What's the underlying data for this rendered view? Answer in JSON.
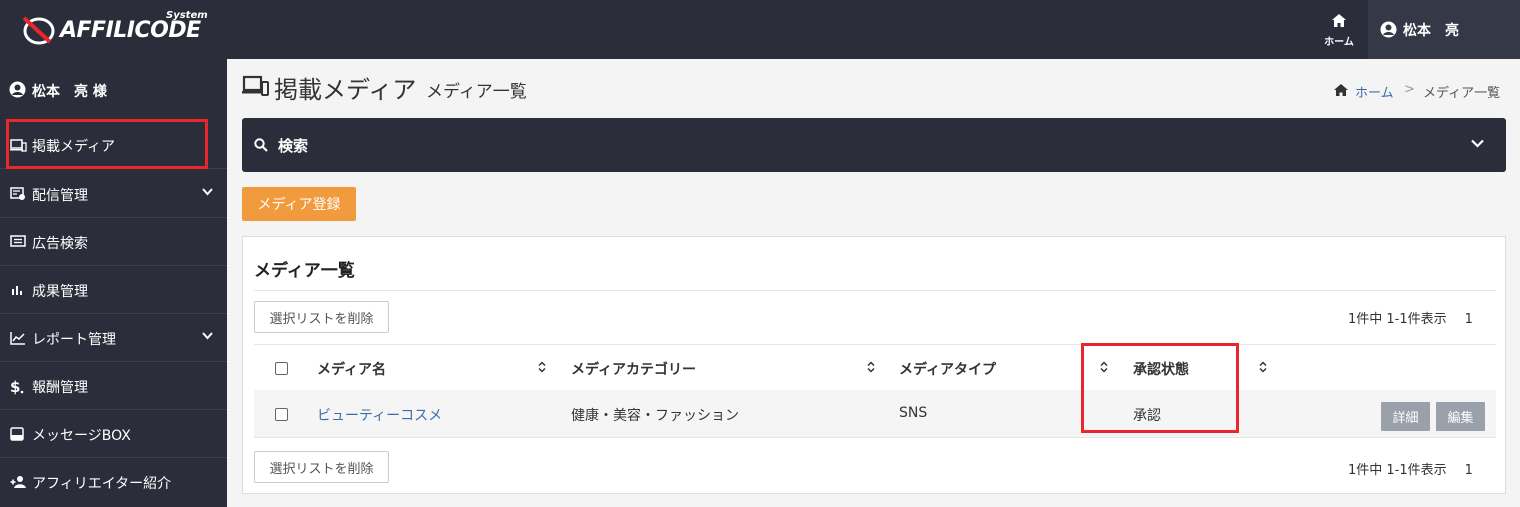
{
  "header": {
    "logo_text": "AFFILICODE",
    "logo_badge": "System",
    "home_label": "ホーム",
    "user_name": "松本　亮"
  },
  "sidebar": {
    "user_label": "松本　亮 様",
    "items": [
      {
        "label": "掲載メディア",
        "icon": "media-icon",
        "expandable": false
      },
      {
        "label": "配信管理",
        "icon": "delivery-icon",
        "expandable": true
      },
      {
        "label": "広告検索",
        "icon": "ad-list-icon",
        "expandable": false
      },
      {
        "label": "成果管理",
        "icon": "bar-chart-icon",
        "expandable": false
      },
      {
        "label": "レポート管理",
        "icon": "line-chart-icon",
        "expandable": true
      },
      {
        "label": "報酬管理",
        "icon": "dollar-icon",
        "expandable": false
      },
      {
        "label": "メッセージBOX",
        "icon": "inbox-icon",
        "expandable": false
      },
      {
        "label": "アフィリエイター紹介",
        "icon": "user-plus-icon",
        "expandable": false
      }
    ]
  },
  "page": {
    "title": "掲載メディア",
    "subtitle": "メディア一覧",
    "breadcrumb": {
      "home": "ホーム",
      "separator": ">",
      "current": "メディア一覧"
    }
  },
  "search": {
    "label": "検索"
  },
  "register_button": "メディア登録",
  "card": {
    "title": "メディア一覧",
    "delete_button": "選択リストを削除",
    "pagination_info": "1件中 1-1件表示",
    "page_number": "1",
    "columns": [
      "メディア名",
      "メディアカテゴリー",
      "メディアタイプ",
      "承認状態"
    ],
    "rows": [
      {
        "name": "ビューティーコスメ",
        "category": "健康・美容・ファッション",
        "type": "SNS",
        "status": "承認",
        "detail_button": "詳細",
        "edit_button": "編集"
      }
    ]
  },
  "colors": {
    "dark_bg": "#2b2d3a",
    "accent_orange": "#f19a3e",
    "link_blue": "#3a6ea8",
    "highlight_red": "#e8262c",
    "action_gray": "#9aa1ab"
  }
}
